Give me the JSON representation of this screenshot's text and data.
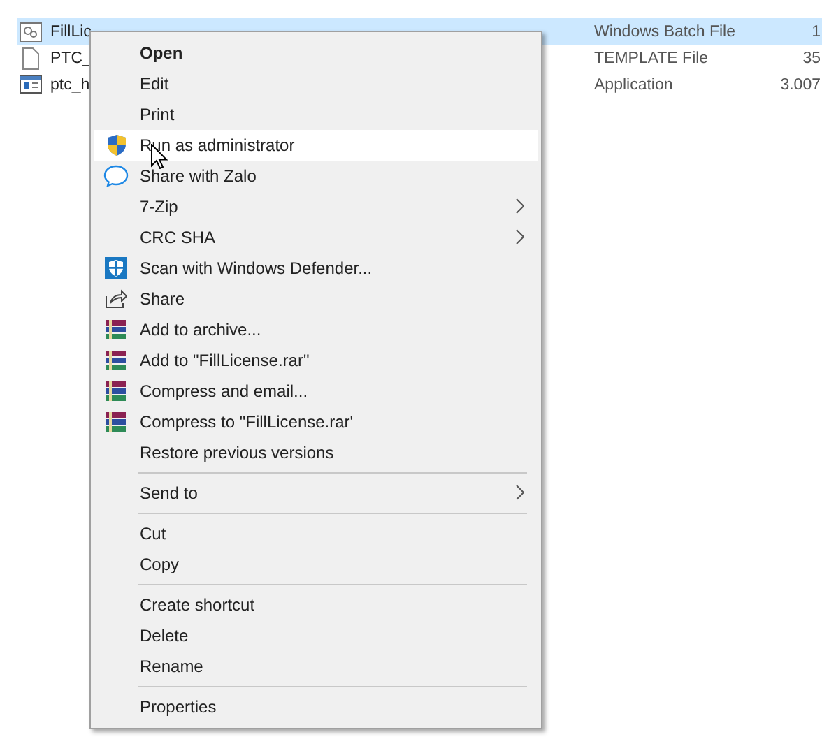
{
  "files": [
    {
      "name": "FillLic",
      "type": "Windows Batch File",
      "size": "1",
      "kind": "batch",
      "selected": true
    },
    {
      "name": "PTC_",
      "type": "TEMPLATE File",
      "size": "35",
      "kind": "document",
      "selected": false
    },
    {
      "name": "ptc_h",
      "type": "Application",
      "size": "3.007",
      "kind": "application",
      "selected": false
    }
  ],
  "context_menu": {
    "items": [
      {
        "kind": "plain",
        "label": "Open",
        "default": true,
        "highlighted": false
      },
      {
        "kind": "plain",
        "label": "Edit",
        "default": false,
        "highlighted": false
      },
      {
        "kind": "plain",
        "label": "Print",
        "default": false,
        "highlighted": false
      },
      {
        "kind": "shield",
        "label": "Run as administrator",
        "default": false,
        "highlighted": true
      },
      {
        "kind": "zalo",
        "label": "Share with Zalo",
        "default": false,
        "highlighted": false
      },
      {
        "kind": "plain",
        "label": "7-Zip",
        "submenu": true,
        "default": false,
        "highlighted": false
      },
      {
        "kind": "plain",
        "label": "CRC SHA",
        "submenu": true,
        "default": false,
        "highlighted": false
      },
      {
        "kind": "defender",
        "label": "Scan with Windows Defender...",
        "default": false,
        "highlighted": false
      },
      {
        "kind": "share",
        "label": "Share",
        "default": false,
        "highlighted": false
      },
      {
        "kind": "archive",
        "label": "Add to archive...",
        "default": false,
        "highlighted": false
      },
      {
        "kind": "archive",
        "label": "Add to \"FillLicense.rar\"",
        "default": false,
        "highlighted": false
      },
      {
        "kind": "archive",
        "label": "Compress and email...",
        "default": false,
        "highlighted": false
      },
      {
        "kind": "archive",
        "label": "Compress to \"FillLicense.rar'",
        "default": false,
        "highlighted": false
      },
      {
        "kind": "plain",
        "label": "Restore previous versions",
        "default": false,
        "highlighted": false
      },
      {
        "kind": "separator"
      },
      {
        "kind": "plain",
        "label": "Send to",
        "submenu": true,
        "default": false,
        "highlighted": false
      },
      {
        "kind": "separator"
      },
      {
        "kind": "plain",
        "label": "Cut",
        "default": false,
        "highlighted": false
      },
      {
        "kind": "plain",
        "label": "Copy",
        "default": false,
        "highlighted": false
      },
      {
        "kind": "separator"
      },
      {
        "kind": "plain",
        "label": "Create shortcut",
        "default": false,
        "highlighted": false
      },
      {
        "kind": "plain",
        "label": "Delete",
        "default": false,
        "highlighted": false
      },
      {
        "kind": "plain",
        "label": "Rename",
        "default": false,
        "highlighted": false
      },
      {
        "kind": "separator"
      },
      {
        "kind": "plain",
        "label": "Properties",
        "default": false,
        "highlighted": false
      }
    ]
  }
}
